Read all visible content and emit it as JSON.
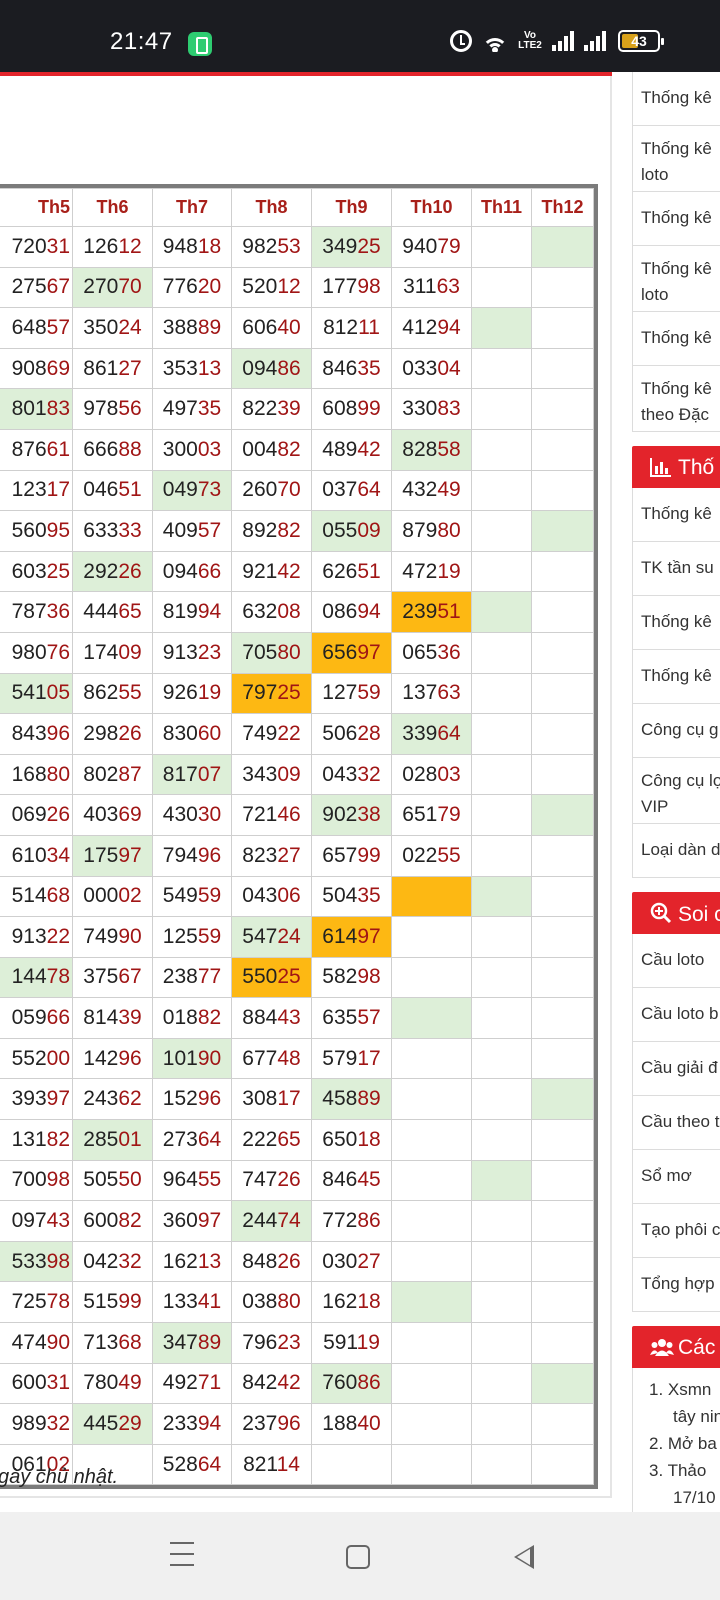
{
  "status_bar": {
    "time": "21:47",
    "volte": "Vo LTE2",
    "battery": "43"
  },
  "table": {
    "headers": [
      "Th5",
      "Th6",
      "Th7",
      "Th8",
      "Th9",
      "Th10",
      "Th11",
      "Th12"
    ],
    "rows": [
      [
        {
          "v": "72031"
        },
        {
          "v": "12612"
        },
        {
          "v": "94818"
        },
        {
          "v": "98253"
        },
        {
          "v": "34925",
          "bg": "g"
        },
        {
          "v": "94079"
        },
        {
          "v": ""
        },
        {
          "v": "",
          "bg": "g"
        }
      ],
      [
        {
          "v": "27567"
        },
        {
          "v": "27070",
          "bg": "g"
        },
        {
          "v": "77620"
        },
        {
          "v": "52012"
        },
        {
          "v": "17798"
        },
        {
          "v": "31163"
        },
        {
          "v": ""
        },
        {
          "v": ""
        }
      ],
      [
        {
          "v": "64857"
        },
        {
          "v": "35024"
        },
        {
          "v": "38889"
        },
        {
          "v": "60640"
        },
        {
          "v": "81211"
        },
        {
          "v": "41294"
        },
        {
          "v": "",
          "bg": "g"
        },
        {
          "v": ""
        }
      ],
      [
        {
          "v": "90869"
        },
        {
          "v": "86127"
        },
        {
          "v": "35313"
        },
        {
          "v": "09486",
          "bg": "g"
        },
        {
          "v": "84635"
        },
        {
          "v": "03304"
        },
        {
          "v": ""
        },
        {
          "v": ""
        }
      ],
      [
        {
          "v": "80183",
          "bg": "g"
        },
        {
          "v": "97856"
        },
        {
          "v": "49735"
        },
        {
          "v": "82239"
        },
        {
          "v": "60899"
        },
        {
          "v": "33083"
        },
        {
          "v": ""
        },
        {
          "v": ""
        }
      ],
      [
        {
          "v": "87661"
        },
        {
          "v": "66688"
        },
        {
          "v": "30003"
        },
        {
          "v": "00482"
        },
        {
          "v": "48942"
        },
        {
          "v": "82858",
          "bg": "g"
        },
        {
          "v": ""
        },
        {
          "v": ""
        }
      ],
      [
        {
          "v": "12317"
        },
        {
          "v": "04651"
        },
        {
          "v": "04973",
          "bg": "g"
        },
        {
          "v": "26070"
        },
        {
          "v": "03764"
        },
        {
          "v": "43249"
        },
        {
          "v": ""
        },
        {
          "v": ""
        }
      ],
      [
        {
          "v": "56095"
        },
        {
          "v": "63333"
        },
        {
          "v": "40957"
        },
        {
          "v": "89282"
        },
        {
          "v": "05509",
          "bg": "g"
        },
        {
          "v": "87980"
        },
        {
          "v": ""
        },
        {
          "v": "",
          "bg": "g"
        }
      ],
      [
        {
          "v": "60325"
        },
        {
          "v": "29226",
          "bg": "g"
        },
        {
          "v": "09466"
        },
        {
          "v": "92142"
        },
        {
          "v": "62651"
        },
        {
          "v": "47219"
        },
        {
          "v": ""
        },
        {
          "v": ""
        }
      ],
      [
        {
          "v": "78736"
        },
        {
          "v": "44465"
        },
        {
          "v": "81994"
        },
        {
          "v": "63208"
        },
        {
          "v": "08694"
        },
        {
          "v": "23951",
          "bg": "o"
        },
        {
          "v": "",
          "bg": "g"
        },
        {
          "v": ""
        }
      ],
      [
        {
          "v": "98076"
        },
        {
          "v": "17409"
        },
        {
          "v": "91323"
        },
        {
          "v": "70580",
          "bg": "g"
        },
        {
          "v": "65697",
          "bg": "o"
        },
        {
          "v": "06536"
        },
        {
          "v": ""
        },
        {
          "v": ""
        }
      ],
      [
        {
          "v": "54105",
          "bg": "g"
        },
        {
          "v": "86255"
        },
        {
          "v": "92619"
        },
        {
          "v": "79725",
          "bg": "o"
        },
        {
          "v": "12759"
        },
        {
          "v": "13763"
        },
        {
          "v": ""
        },
        {
          "v": ""
        }
      ],
      [
        {
          "v": "84396"
        },
        {
          "v": "29826"
        },
        {
          "v": "83060"
        },
        {
          "v": "74922"
        },
        {
          "v": "50628"
        },
        {
          "v": "33964",
          "bg": "g"
        },
        {
          "v": ""
        },
        {
          "v": ""
        }
      ],
      [
        {
          "v": "16880"
        },
        {
          "v": "80287"
        },
        {
          "v": "81707",
          "bg": "g"
        },
        {
          "v": "34309"
        },
        {
          "v": "04332"
        },
        {
          "v": "02803"
        },
        {
          "v": ""
        },
        {
          "v": ""
        }
      ],
      [
        {
          "v": "06926"
        },
        {
          "v": "40369"
        },
        {
          "v": "43030"
        },
        {
          "v": "72146"
        },
        {
          "v": "90238",
          "bg": "g"
        },
        {
          "v": "65179"
        },
        {
          "v": ""
        },
        {
          "v": "",
          "bg": "g"
        }
      ],
      [
        {
          "v": "61034"
        },
        {
          "v": "17597",
          "bg": "g"
        },
        {
          "v": "79496"
        },
        {
          "v": "82327"
        },
        {
          "v": "65799"
        },
        {
          "v": "02255"
        },
        {
          "v": ""
        },
        {
          "v": ""
        }
      ],
      [
        {
          "v": "51468"
        },
        {
          "v": "00002"
        },
        {
          "v": "54959"
        },
        {
          "v": "04306"
        },
        {
          "v": "50435"
        },
        {
          "v": "",
          "bg": "o"
        },
        {
          "v": "",
          "bg": "g"
        },
        {
          "v": ""
        }
      ],
      [
        {
          "v": "91322"
        },
        {
          "v": "74990"
        },
        {
          "v": "12559"
        },
        {
          "v": "54724",
          "bg": "g"
        },
        {
          "v": "61497",
          "bg": "o"
        },
        {
          "v": ""
        },
        {
          "v": ""
        },
        {
          "v": ""
        }
      ],
      [
        {
          "v": "14478",
          "bg": "g"
        },
        {
          "v": "37567"
        },
        {
          "v": "23877"
        },
        {
          "v": "55025",
          "bg": "o"
        },
        {
          "v": "58298"
        },
        {
          "v": ""
        },
        {
          "v": ""
        },
        {
          "v": ""
        }
      ],
      [
        {
          "v": "05966"
        },
        {
          "v": "81439"
        },
        {
          "v": "01882"
        },
        {
          "v": "88443"
        },
        {
          "v": "63557"
        },
        {
          "v": "",
          "bg": "g"
        },
        {
          "v": ""
        },
        {
          "v": ""
        }
      ],
      [
        {
          "v": "55200"
        },
        {
          "v": "14296"
        },
        {
          "v": "10190",
          "bg": "g"
        },
        {
          "v": "67748"
        },
        {
          "v": "57917"
        },
        {
          "v": ""
        },
        {
          "v": ""
        },
        {
          "v": ""
        }
      ],
      [
        {
          "v": "39397"
        },
        {
          "v": "24362"
        },
        {
          "v": "15296"
        },
        {
          "v": "30817"
        },
        {
          "v": "45889",
          "bg": "g"
        },
        {
          "v": ""
        },
        {
          "v": ""
        },
        {
          "v": "",
          "bg": "g"
        }
      ],
      [
        {
          "v": "13182"
        },
        {
          "v": "28501",
          "bg": "g"
        },
        {
          "v": "27364"
        },
        {
          "v": "22265"
        },
        {
          "v": "65018"
        },
        {
          "v": ""
        },
        {
          "v": ""
        },
        {
          "v": ""
        }
      ],
      [
        {
          "v": "70098"
        },
        {
          "v": "50550"
        },
        {
          "v": "96455"
        },
        {
          "v": "74726"
        },
        {
          "v": "84645"
        },
        {
          "v": ""
        },
        {
          "v": "",
          "bg": "g"
        },
        {
          "v": ""
        }
      ],
      [
        {
          "v": "09743"
        },
        {
          "v": "60082"
        },
        {
          "v": "36097"
        },
        {
          "v": "24474",
          "bg": "g"
        },
        {
          "v": "77286"
        },
        {
          "v": ""
        },
        {
          "v": ""
        },
        {
          "v": ""
        }
      ],
      [
        {
          "v": "53398",
          "bg": "g"
        },
        {
          "v": "04232"
        },
        {
          "v": "16213"
        },
        {
          "v": "84826"
        },
        {
          "v": "03027"
        },
        {
          "v": ""
        },
        {
          "v": ""
        },
        {
          "v": ""
        }
      ],
      [
        {
          "v": "72578"
        },
        {
          "v": "51599"
        },
        {
          "v": "13341"
        },
        {
          "v": "03880"
        },
        {
          "v": "16218"
        },
        {
          "v": "",
          "bg": "g"
        },
        {
          "v": ""
        },
        {
          "v": ""
        }
      ],
      [
        {
          "v": "47490"
        },
        {
          "v": "71368"
        },
        {
          "v": "34789",
          "bg": "g"
        },
        {
          "v": "79623"
        },
        {
          "v": "59119"
        },
        {
          "v": ""
        },
        {
          "v": ""
        },
        {
          "v": ""
        }
      ],
      [
        {
          "v": "60031"
        },
        {
          "v": "78049"
        },
        {
          "v": "49271"
        },
        {
          "v": "84242"
        },
        {
          "v": "76086",
          "bg": "g"
        },
        {
          "v": ""
        },
        {
          "v": ""
        },
        {
          "v": "",
          "bg": "g"
        }
      ],
      [
        {
          "v": "98932"
        },
        {
          "v": "44529",
          "bg": "g"
        },
        {
          "v": "23394"
        },
        {
          "v": "23796"
        },
        {
          "v": "18840"
        },
        {
          "v": ""
        },
        {
          "v": ""
        },
        {
          "v": ""
        }
      ],
      [
        {
          "v": "06102"
        },
        {
          "v": ""
        },
        {
          "v": "52864"
        },
        {
          "v": "82114"
        },
        {
          "v": ""
        },
        {
          "v": ""
        },
        {
          "v": ""
        },
        {
          "v": ""
        }
      ]
    ]
  },
  "note": "gày chủ nhật.",
  "sidebar": {
    "group1": [
      {
        "label": "Thống kê",
        "tall": false
      },
      {
        "label": "Thống kê loto",
        "tall": true
      },
      {
        "label": "Thống kê",
        "tall": false
      },
      {
        "label": "Thống kê loto",
        "tall": true
      },
      {
        "label": "Thống kê",
        "tall": false
      },
      {
        "label": "Thống kê theo Đặc",
        "tall": true
      }
    ],
    "head2": "Thố",
    "group2": [
      {
        "label": "Thống kê",
        "tall": false
      },
      {
        "label": "TK tần su",
        "tall": false
      },
      {
        "label": "Thống kê",
        "tall": false
      },
      {
        "label": "Thống kê",
        "tall": false
      },
      {
        "label": "Công cụ g",
        "tall": false
      },
      {
        "label": "Công cụ lọ VIP",
        "tall": true
      },
      {
        "label": "Loại dàn d",
        "tall": false
      }
    ],
    "head3": "Soi c",
    "group3": [
      {
        "label": "Cầu loto",
        "tall": false
      },
      {
        "label": "Cầu loto b",
        "tall": false
      },
      {
        "label": "Cầu giải đ",
        "tall": false
      },
      {
        "label": "Cầu theo t",
        "tall": false
      },
      {
        "label": "Sổ mơ",
        "tall": false
      },
      {
        "label": "Tạo phôi c",
        "tall": false
      },
      {
        "label": "Tổng hợp",
        "tall": false
      }
    ],
    "head4": "Các",
    "list4": [
      "1. Xsmn",
      "tây nin",
      "2. Mở ba",
      "3. Thảo",
      "17/10"
    ]
  },
  "colors": {
    "accent_red": "#e3242b",
    "green_cell": "#ddefd8",
    "orange_cell": "#fdb813",
    "tail_digits": "#a01515"
  }
}
